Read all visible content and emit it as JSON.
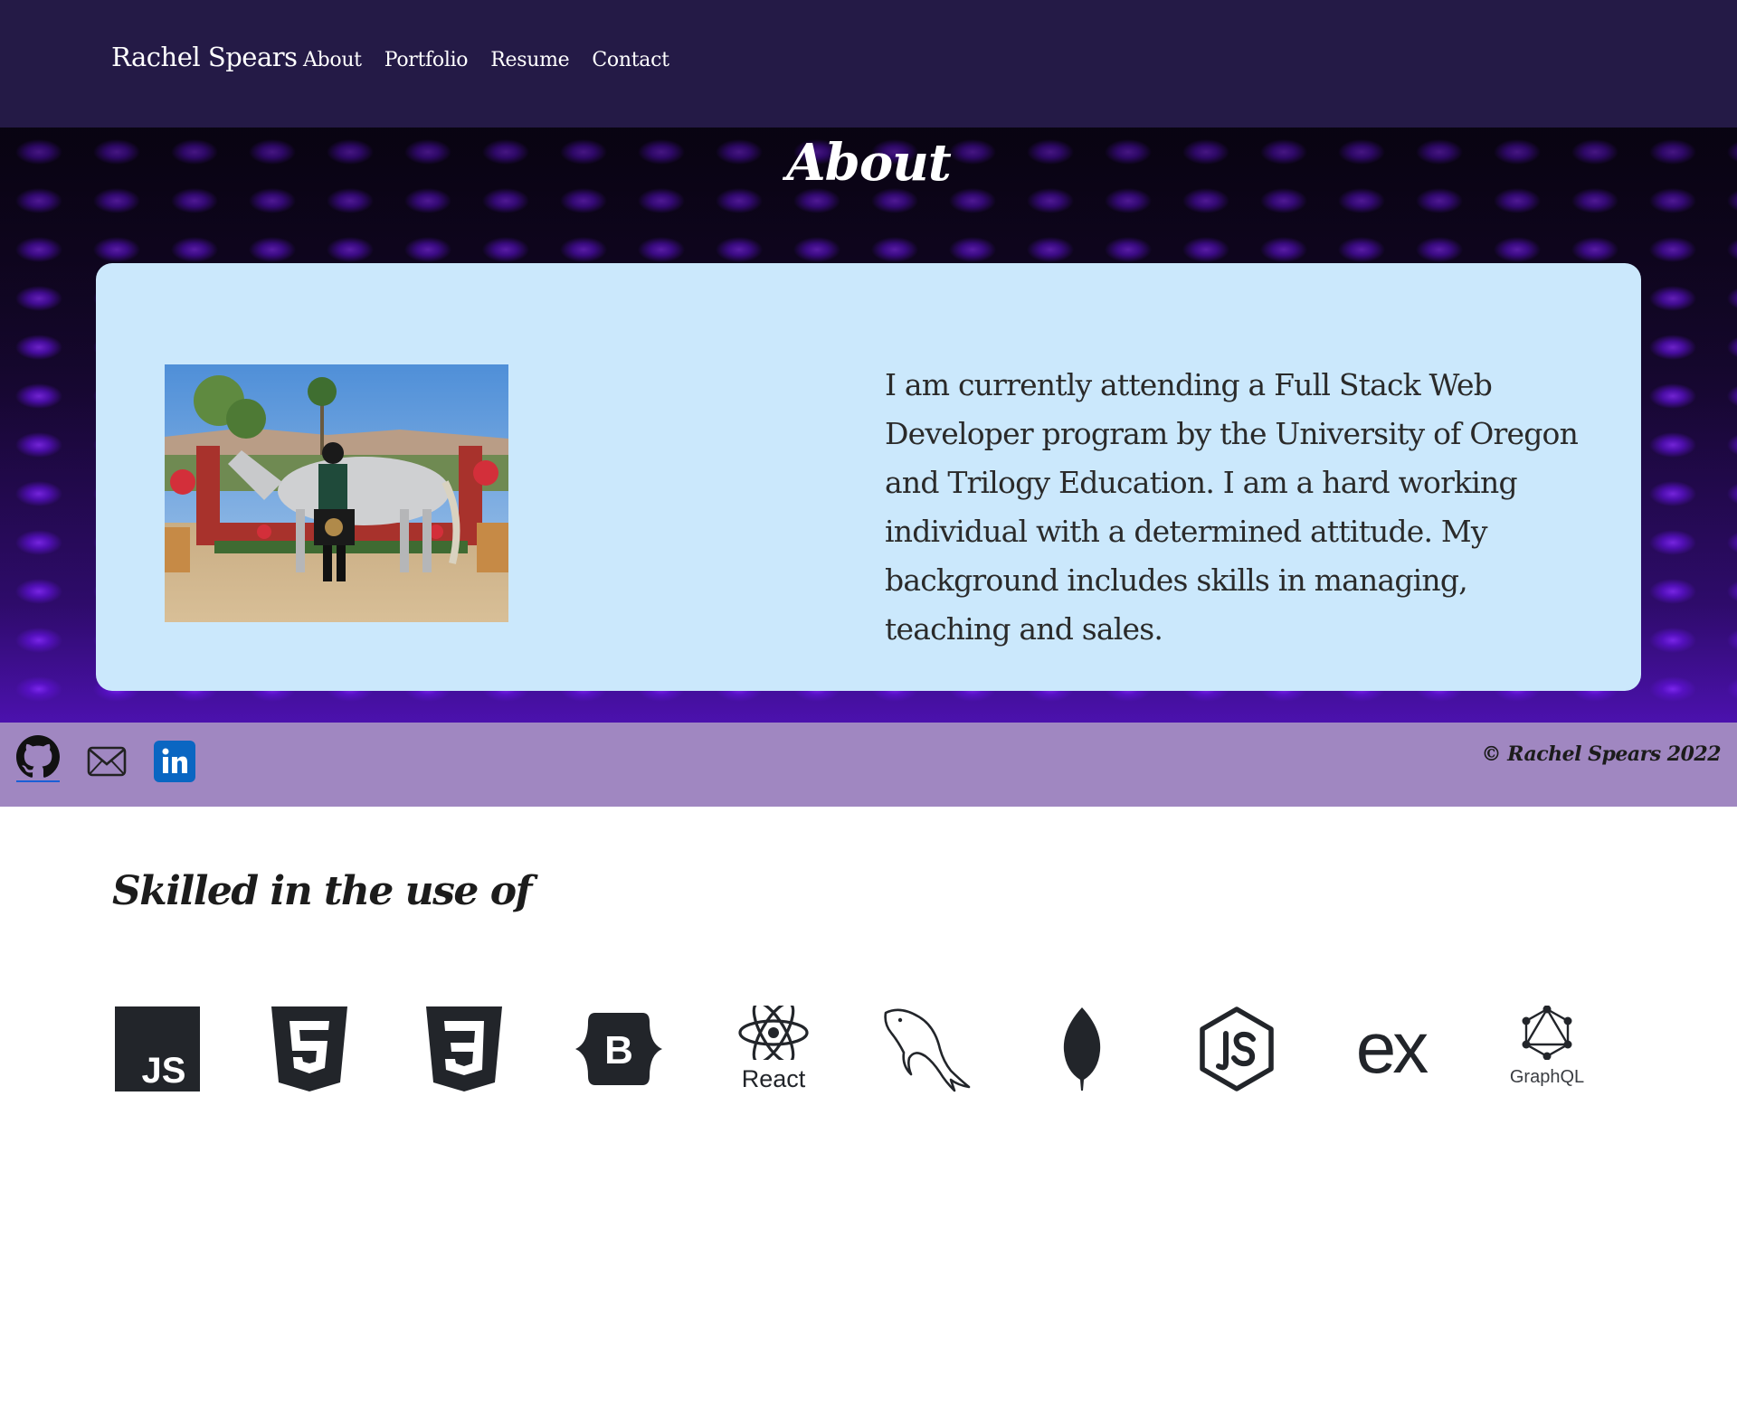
{
  "navbar": {
    "brand": "Rachel Spears",
    "links": [
      "About",
      "Portfolio",
      "Resume",
      "Contact"
    ]
  },
  "hero": {
    "title": "About",
    "about_text": "I am currently attending a Full Stack Web Developer program by the University of Oregon and Trilogy Education. I am a hard working individual with a determined attitude. My background includes skills in managing, teaching and sales."
  },
  "footer": {
    "social_icons": [
      "github-icon",
      "mail-icon",
      "linkedin-icon"
    ],
    "copyright": "© Rachel Spears 2022"
  },
  "skills": {
    "title": "Skilled in the use of",
    "items": [
      {
        "icon": "javascript-icon"
      },
      {
        "icon": "html5-icon"
      },
      {
        "icon": "css3-icon"
      },
      {
        "icon": "bootstrap-icon"
      },
      {
        "icon": "react-icon",
        "label": "React"
      },
      {
        "icon": "mysql-icon"
      },
      {
        "icon": "mongodb-icon"
      },
      {
        "icon": "nodejs-icon"
      },
      {
        "icon": "express-icon",
        "label": "ex"
      },
      {
        "icon": "graphql-icon",
        "label": "GraphQL"
      }
    ]
  },
  "colors": {
    "navbar_bg": "#241a46",
    "card_bg": "#cbe8fc",
    "footer_bg": "#a087c1",
    "icon_dark": "#22252a",
    "linkedin_blue": "#0a66c2"
  }
}
